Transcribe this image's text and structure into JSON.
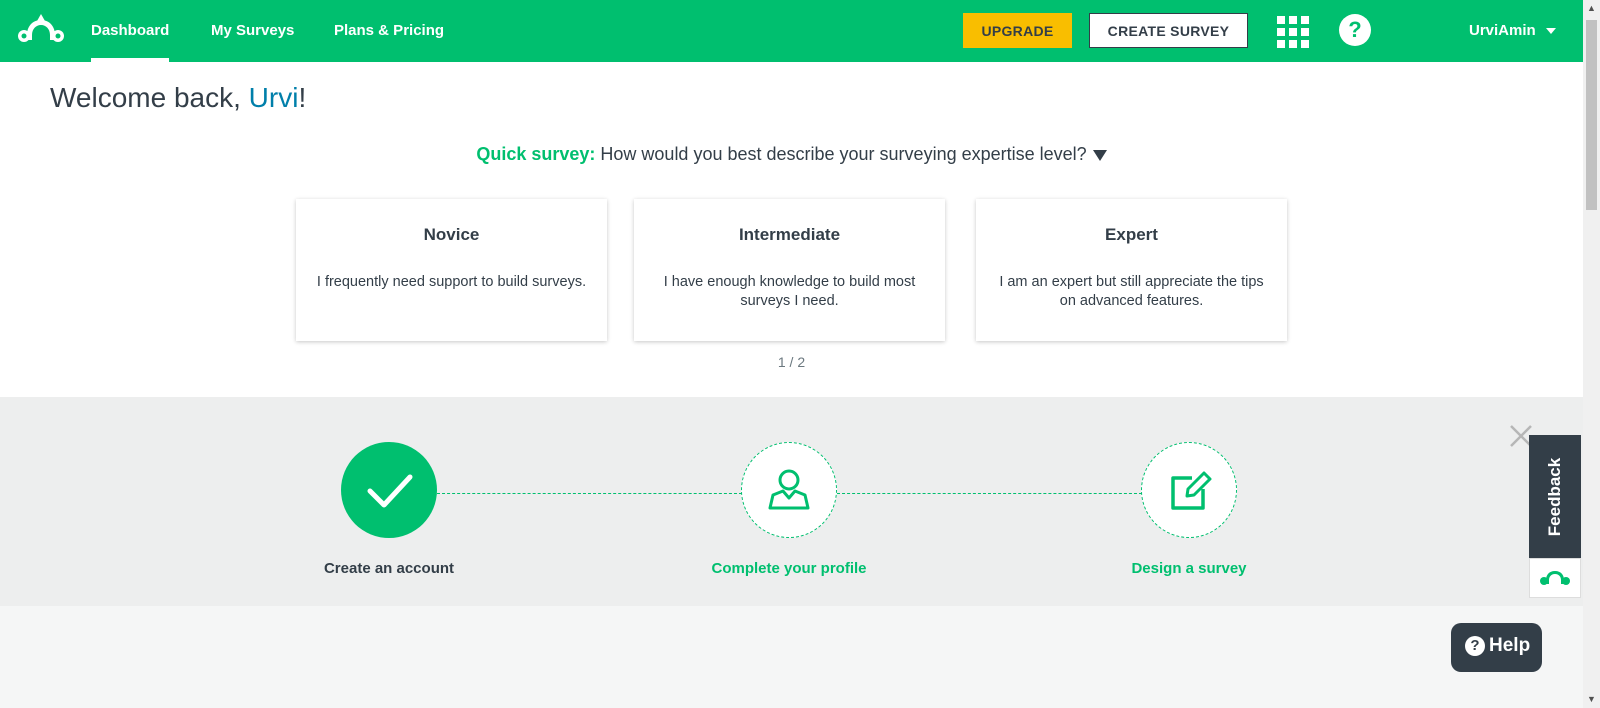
{
  "nav": {
    "links": [
      "Dashboard",
      "My Surveys",
      "Plans & Pricing"
    ],
    "upgrade_label": "UPGRADE",
    "create_survey_label": "CREATE SURVEY",
    "help_glyph": "?",
    "user_name": "UrviAmin"
  },
  "welcome": {
    "greeting": "Welcome back, ",
    "name": "Urvi",
    "punct": "!"
  },
  "quick_survey": {
    "label": "Quick survey:",
    "question": " How would you best describe your surveying expertise level?",
    "options": [
      {
        "title": "Novice",
        "desc": "I frequently need support to build surveys."
      },
      {
        "title": "Intermediate",
        "desc": "I have enough knowledge to build most surveys I need."
      },
      {
        "title": "Expert",
        "desc": "I am an expert but still appreciate the tips on advanced features."
      }
    ],
    "pager": "1 / 2"
  },
  "progress": {
    "steps": [
      {
        "label": "Create an account",
        "status": "done",
        "icon": "checkmark-icon"
      },
      {
        "label": "Complete your profile",
        "status": "todo",
        "icon": "user-profile-icon"
      },
      {
        "label": "Design a survey",
        "status": "todo",
        "icon": "edit-icon"
      }
    ]
  },
  "feedback": {
    "label": "Feedback"
  },
  "help_widget": {
    "label": "Help",
    "glyph": "?"
  },
  "colors": {
    "brand_green": "#00bf6f",
    "upgrade_yellow": "#f9be00",
    "dark_text": "#333e48",
    "link_blue": "#007faa"
  }
}
